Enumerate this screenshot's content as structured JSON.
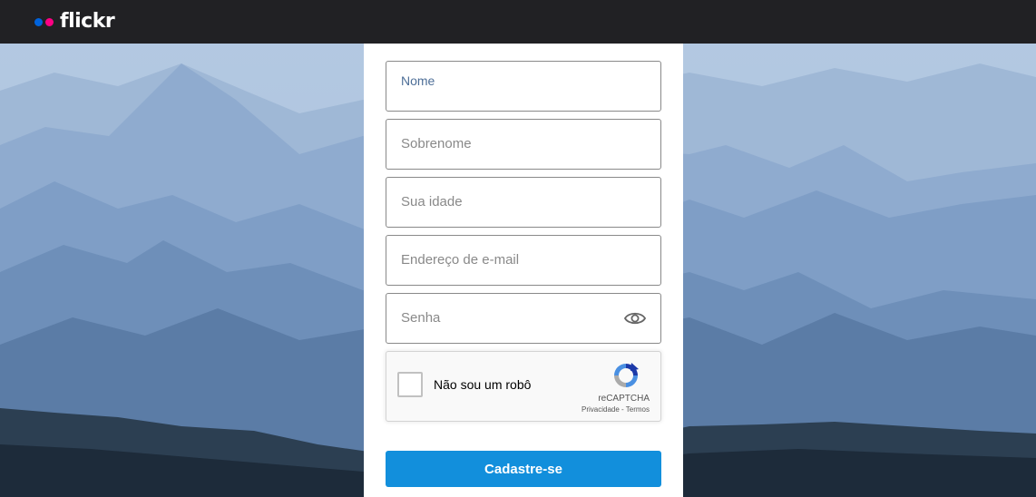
{
  "app": {
    "logo_text": "flickr",
    "logo_colors": {
      "blue": "#0063dc",
      "pink": "#ff0084"
    }
  },
  "form": {
    "first_name_placeholder": "Nome",
    "last_name_placeholder": "Sobrenome",
    "age_placeholder": "Sua idade",
    "email_placeholder": "Endereço de e-mail",
    "password_placeholder": "Senha",
    "password_toggle_icon": "eye-icon",
    "captcha": {
      "label": "Não sou um robô",
      "brand": "reCAPTCHA",
      "privacy": "Privacidade",
      "separator": " - ",
      "terms": "Termos"
    },
    "submit_label": "Cadastre-se",
    "accent_color": "#128fdc"
  }
}
